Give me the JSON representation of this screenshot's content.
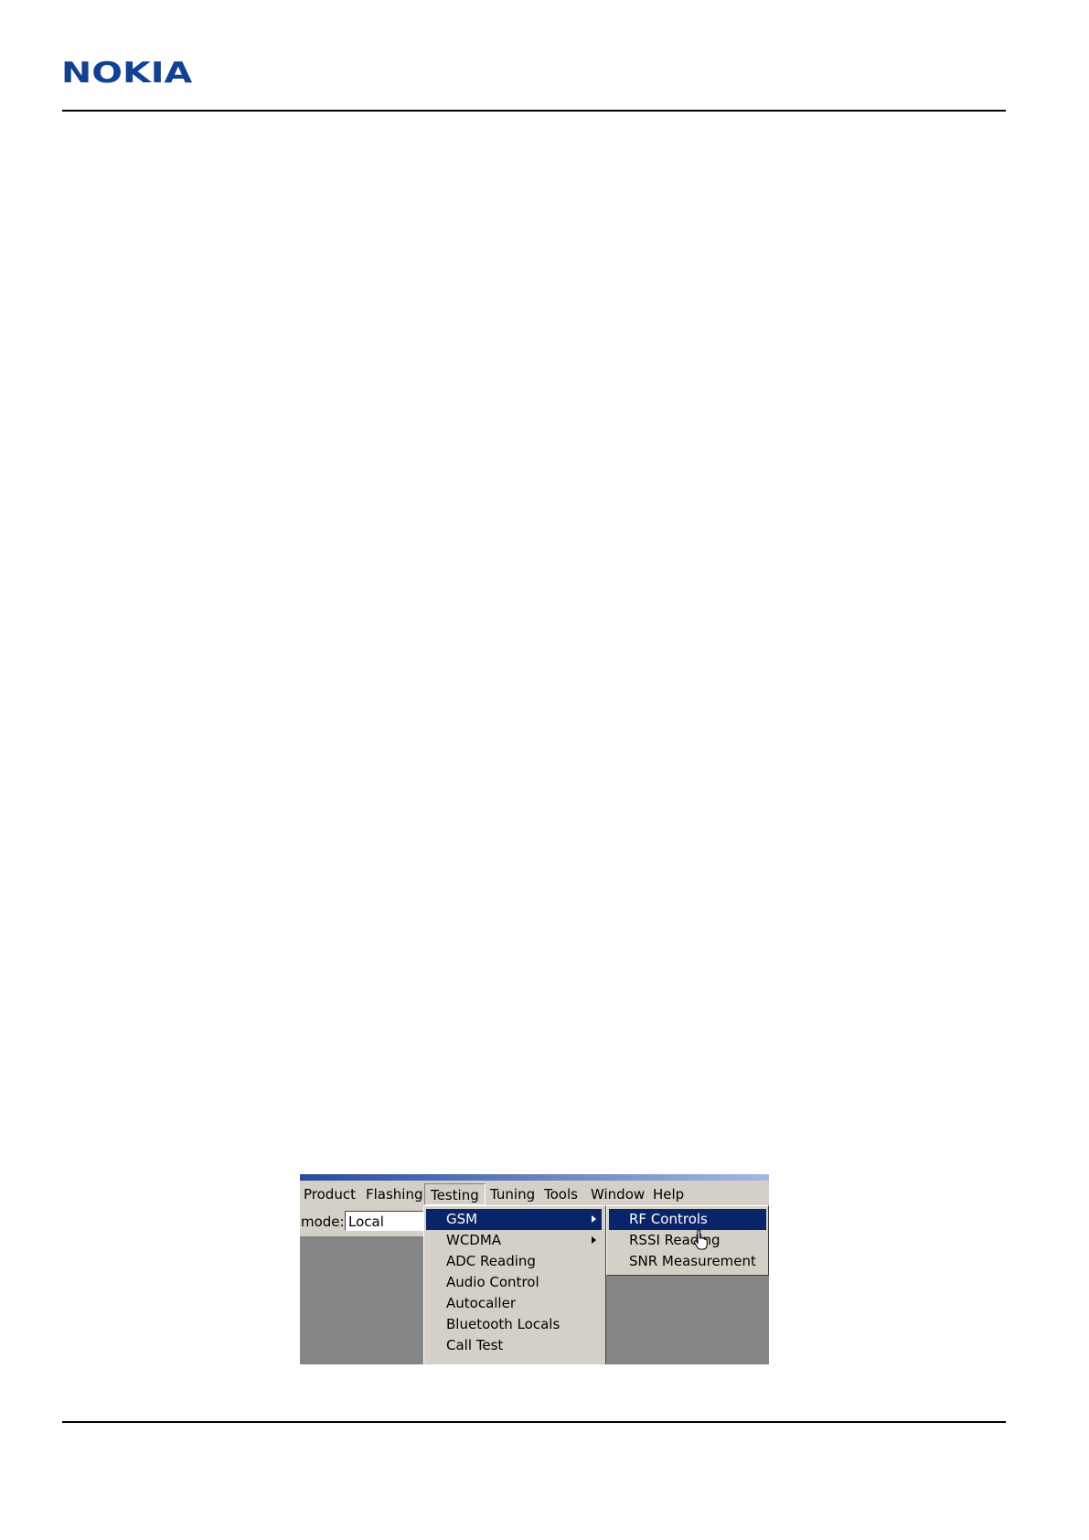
{
  "header": {
    "logo_text": "NOKIA",
    "brand_color": "#124191"
  },
  "screenshot": {
    "menubar": [
      "Product",
      "Flashing",
      "Testing",
      "Tuning",
      "Tools",
      "Window",
      "Help"
    ],
    "mode_label": "mode:",
    "mode_value": "Local",
    "testing_menu": [
      {
        "label": "GSM",
        "submenu": true,
        "selected": true
      },
      {
        "label": "WCDMA",
        "submenu": true,
        "selected": false
      },
      {
        "label": "ADC Reading",
        "submenu": false,
        "selected": false
      },
      {
        "label": "Audio Control",
        "submenu": false,
        "selected": false
      },
      {
        "label": "Autocaller",
        "submenu": false,
        "selected": false
      },
      {
        "label": "Bluetooth Locals",
        "submenu": false,
        "selected": false
      },
      {
        "label": "Call Test",
        "submenu": false,
        "selected": false
      }
    ],
    "gsm_submenu": [
      {
        "label": "RF Controls",
        "selected": true
      },
      {
        "label": "RSSI Reading",
        "selected": false
      },
      {
        "label": "SNR Measurement",
        "selected": false
      }
    ],
    "highlight_color": "#0a246a"
  }
}
